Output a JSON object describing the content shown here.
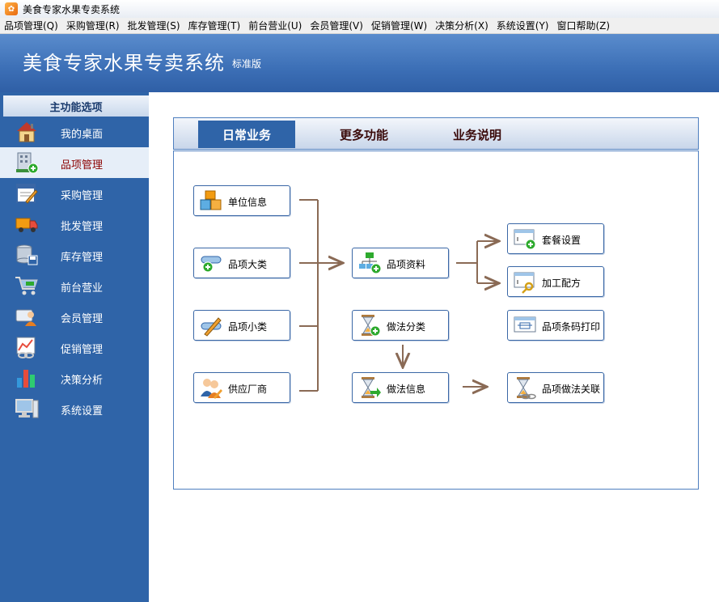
{
  "window": {
    "title": "美食专家水果专卖系统"
  },
  "menu": [
    "品项管理(Q)",
    "采购管理(R)",
    "批发管理(S)",
    "库存管理(T)",
    "前台营业(U)",
    "会员管理(V)",
    "促销管理(W)",
    "决策分析(X)",
    "系统设置(Y)",
    "窗口帮助(Z)"
  ],
  "header": {
    "app_name": "美食专家水果专卖系统",
    "edition": "标准版"
  },
  "sidebar": {
    "title": "主功能选项",
    "items": [
      {
        "label": "我的桌面",
        "icon": "house-icon"
      },
      {
        "label": "品项管理",
        "icon": "building-add-icon"
      },
      {
        "label": "采购管理",
        "icon": "form-pencil-icon"
      },
      {
        "label": "批发管理",
        "icon": "truck-icon"
      },
      {
        "label": "库存管理",
        "icon": "database-save-icon"
      },
      {
        "label": "前台营业",
        "icon": "shopping-cart-icon"
      },
      {
        "label": "会员管理",
        "icon": "member-card-icon"
      },
      {
        "label": "促销管理",
        "icon": "chart-chain-icon"
      },
      {
        "label": "决策分析",
        "icon": "bar-chart-icon"
      },
      {
        "label": "系统设置",
        "icon": "computer-icon"
      }
    ]
  },
  "tabs": [
    "日常业务",
    "更多功能",
    "业务说明"
  ],
  "flow": {
    "unit_info": "单位信息",
    "category_major": "品项大类",
    "category_minor": "品项小类",
    "supplier": "供应厂商",
    "item_data": "品项资料",
    "method_category": "做法分类",
    "method_info": "做法信息",
    "combo_setting": "套餐设置",
    "processing_recipe": "加工配方",
    "barcode_print": "品项条码打印",
    "item_method_link": "品项做法关联"
  }
}
